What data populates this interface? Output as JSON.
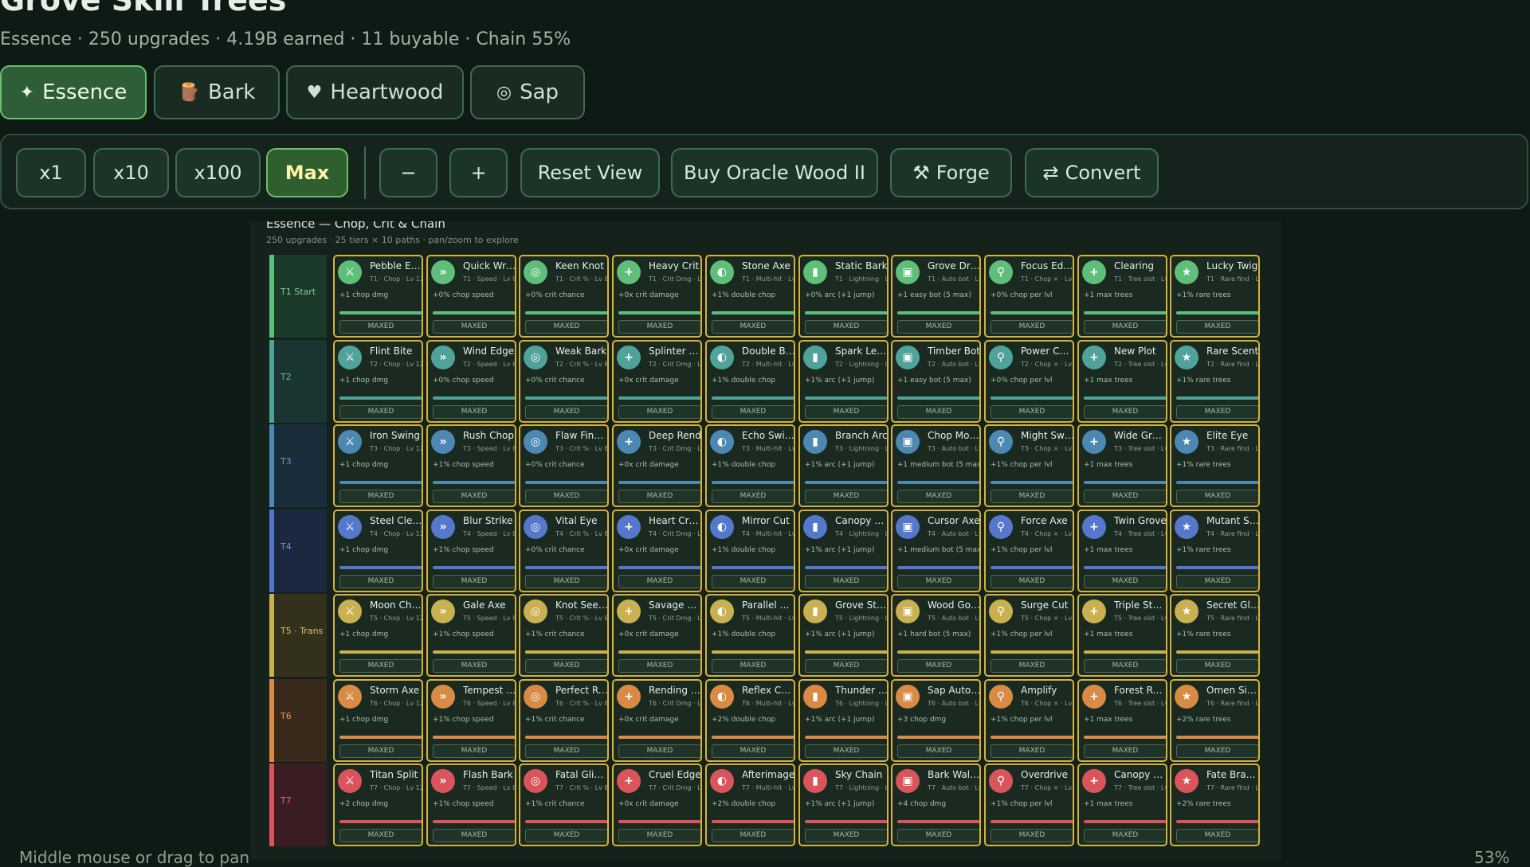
{
  "header": {
    "title": "Grove Skill Trees",
    "subtitle": "Essence · 250 upgrades · 4.19B earned · 11 buyable · Chain 55%"
  },
  "tabs": [
    {
      "icon": "✦",
      "label": "Essence",
      "active": true
    },
    {
      "icon": "🪵",
      "label": "Bark",
      "active": false
    },
    {
      "icon": "♥",
      "label": "Heartwood",
      "active": false
    },
    {
      "icon": "◎",
      "label": "Sap",
      "active": false
    }
  ],
  "toolbar": {
    "qty": [
      "x1",
      "x10",
      "x100",
      "Max"
    ],
    "qty_active": "Max",
    "zoom_out": "−",
    "zoom_in": "+",
    "reset": "Reset View",
    "buy": "Buy Oracle Wood II",
    "forge_icon": "⚒",
    "forge": "Forge",
    "convert_icon": "⇄",
    "convert": "Convert"
  },
  "board": {
    "title": "Essence — Chop, Crit & Chain",
    "subtitle": "250 upgrades · 25 tiers × 10 paths · pan/zoom to explore"
  },
  "tiers": [
    {
      "label": "T1 Start",
      "color": "#5fbf7a",
      "bg": "#1c3a2a",
      "text": "#7fcf8f"
    },
    {
      "label": "T2",
      "color": "#4fa39a",
      "bg": "#1a3532",
      "text": "#6fb3aa"
    },
    {
      "label": "T3",
      "color": "#4d88b3",
      "bg": "#1a2d3a",
      "text": "#6d98c3"
    },
    {
      "label": "T4",
      "color": "#5577cc",
      "bg": "#1c2740",
      "text": "#7597dc"
    },
    {
      "label": "T5 · Trans",
      "color": "#c9b050",
      "bg": "#33301e",
      "text": "#d9c070"
    },
    {
      "label": "T6",
      "color": "#d98a45",
      "bg": "#3a2a1c",
      "text": "#e99a55"
    },
    {
      "label": "T7",
      "color": "#d9555b",
      "bg": "#3a1d22",
      "text": "#e9656b"
    }
  ],
  "paths": [
    {
      "icon": "⚔",
      "effect": "+1 chop dmg",
      "meta": "Chop · Lv 12"
    },
    {
      "icon": "»",
      "effect": "+0% chop speed",
      "meta": "Speed · Lv 8"
    },
    {
      "icon": "◎",
      "effect": "+0% crit chance",
      "meta": "Crit % · Lv 8"
    },
    {
      "icon": "+",
      "effect": "+0x crit damage",
      "meta": "Crit Dmg · Lv"
    },
    {
      "icon": "◐",
      "effect": "+1% double chop",
      "meta": "Multi-hit · Lv"
    },
    {
      "icon": "▮",
      "effect": "+0% arc (+1 jump)",
      "meta": "Lightning · Lv"
    },
    {
      "icon": "▣",
      "effect": "+1 easy bot (5 max)",
      "meta": "Auto bot · Lv"
    },
    {
      "icon": "⚲",
      "effect": "+0% chop per lvl",
      "meta": "Chop × · Lv 5"
    },
    {
      "icon": "+",
      "effect": "+1 max trees",
      "meta": "Tree slot · Lv"
    },
    {
      "icon": "★",
      "effect": "+1% rare trees",
      "meta": "Rare find · Lv 6"
    }
  ],
  "maxed_label": "MAXED",
  "grid": [
    [
      {
        "name": "Pebble Edge",
        "tier": "T1",
        "effect": "+1 chop dmg"
      },
      {
        "name": "Quick Wrist",
        "tier": "T1",
        "effect": "+0% chop speed"
      },
      {
        "name": "Keen Knot",
        "tier": "T1",
        "effect": "+0% crit chance"
      },
      {
        "name": "Heavy Crit",
        "tier": "T1",
        "effect": "+0x crit damage"
      },
      {
        "name": "Stone Axe",
        "tier": "T1",
        "effect": "+1% double chop"
      },
      {
        "name": "Static Bark",
        "tier": "T1",
        "effect": "+0% arc (+1 jump)"
      },
      {
        "name": "Grove Drone",
        "tier": "T1",
        "effect": "+1 easy bot (5 max)"
      },
      {
        "name": "Focus Edge",
        "tier": "T1",
        "effect": "+0% chop per lvl"
      },
      {
        "name": "Clearing",
        "tier": "T1",
        "effect": "+1 max trees"
      },
      {
        "name": "Lucky Twig",
        "tier": "T1",
        "effect": "+1% rare trees"
      }
    ],
    [
      {
        "name": "Flint Bite",
        "tier": "T2",
        "effect": "+1 chop dmg"
      },
      {
        "name": "Wind Edge",
        "tier": "T2",
        "effect": "+0% chop speed"
      },
      {
        "name": "Weak Bark",
        "tier": "T2",
        "effect": "+0% crit chance"
      },
      {
        "name": "Splinter Burst",
        "tier": "T2",
        "effect": "+0x crit damage"
      },
      {
        "name": "Double Bite",
        "tier": "T2",
        "effect": "+1% double chop"
      },
      {
        "name": "Spark Leap",
        "tier": "T2",
        "effect": "+1% arc (+1 jump)"
      },
      {
        "name": "Timber Bot",
        "tier": "T2",
        "effect": "+1 easy bot (5 max)"
      },
      {
        "name": "Power Chop",
        "tier": "T2",
        "effect": "+0% chop per lvl"
      },
      {
        "name": "New Plot",
        "tier": "T2",
        "effect": "+1 max trees"
      },
      {
        "name": "Rare Scent",
        "tier": "T2",
        "effect": "+1% rare trees"
      }
    ],
    [
      {
        "name": "Iron Swing",
        "tier": "T3",
        "effect": "+1 chop dmg"
      },
      {
        "name": "Rush Chop",
        "tier": "T3",
        "effect": "+1% chop speed"
      },
      {
        "name": "Flaw Finder",
        "tier": "T3",
        "effect": "+0% crit chance"
      },
      {
        "name": "Deep Rend",
        "tier": "T3",
        "effect": "+0x crit damage"
      },
      {
        "name": "Echo Swing",
        "tier": "T3",
        "effect": "+1% double chop"
      },
      {
        "name": "Branch Arc",
        "tier": "T3",
        "effect": "+1% arc (+1 jump)"
      },
      {
        "name": "Chop Mouser",
        "tier": "T3",
        "effect": "+1 medium bot (5 max)"
      },
      {
        "name": "Might Swing",
        "tier": "T3",
        "effect": "+1% chop per lvl"
      },
      {
        "name": "Wide Grove",
        "tier": "T3",
        "effect": "+1 max trees"
      },
      {
        "name": "Elite Eye",
        "tier": "T3",
        "effect": "+1% rare trees"
      }
    ],
    [
      {
        "name": "Steel Cleaver",
        "tier": "T4",
        "effect": "+1 chop dmg"
      },
      {
        "name": "Blur Strike",
        "tier": "T4",
        "effect": "+1% chop speed"
      },
      {
        "name": "Vital Eye",
        "tier": "T4",
        "effect": "+0% crit chance"
      },
      {
        "name": "Heart Crack",
        "tier": "T4",
        "effect": "+0x crit damage"
      },
      {
        "name": "Mirror Cut",
        "tier": "T4",
        "effect": "+1% double chop"
      },
      {
        "name": "Canopy Bolt",
        "tier": "T4",
        "effect": "+1% arc (+1 jump)"
      },
      {
        "name": "Cursor Axe",
        "tier": "T4",
        "effect": "+1 medium bot (5 max)"
      },
      {
        "name": "Force Axe",
        "tier": "T4",
        "effect": "+1% chop per lvl"
      },
      {
        "name": "Twin Grove",
        "tier": "T4",
        "effect": "+1 max trees"
      },
      {
        "name": "Mutant Sense",
        "tier": "T4",
        "effect": "+1% rare trees"
      }
    ],
    [
      {
        "name": "Moon Chop",
        "tier": "T5",
        "effect": "+1 chop dmg"
      },
      {
        "name": "Gale Axe",
        "tier": "T5",
        "effect": "+1% chop speed"
      },
      {
        "name": "Knot Seeker",
        "tier": "T5",
        "effect": "+1% crit chance"
      },
      {
        "name": "Savage Mark",
        "tier": "T5",
        "effect": "+0x crit damage"
      },
      {
        "name": "Parallel Axe",
        "tier": "T5",
        "effect": "+1% double chop"
      },
      {
        "name": "Grove Storm",
        "tier": "T5",
        "effect": "+1% arc (+1 jump)"
      },
      {
        "name": "Wood Golem",
        "tier": "T5",
        "effect": "+1 hard bot (5 max)"
      },
      {
        "name": "Surge Cut",
        "tier": "T5",
        "effect": "+1% chop per lvl"
      },
      {
        "name": "Triple Stand",
        "tier": "T5",
        "effect": "+1 max trees"
      },
      {
        "name": "Secret Glimmer",
        "tier": "T5",
        "effect": "+1% rare trees"
      }
    ],
    [
      {
        "name": "Storm Axe",
        "tier": "T6",
        "effect": "+1 chop dmg"
      },
      {
        "name": "Tempest Axe",
        "tier": "T6",
        "effect": "+1% chop speed"
      },
      {
        "name": "Perfect Rend",
        "tier": "T6",
        "effect": "+1% crit chance"
      },
      {
        "name": "Rending Blow",
        "tier": "T6",
        "effect": "+0x crit damage"
      },
      {
        "name": "Reflex Chop",
        "tier": "T6",
        "effect": "+2% double chop"
      },
      {
        "name": "Thunder Line",
        "tier": "T6",
        "effect": "+1% arc (+1 jump)"
      },
      {
        "name": "Sap Automaton",
        "tier": "T6",
        "effect": "+3 chop dmg"
      },
      {
        "name": "Amplify",
        "tier": "T6",
        "effect": "+1% chop per lvl"
      },
      {
        "name": "Forest Room",
        "tier": "T6",
        "effect": "+1 max trees"
      },
      {
        "name": "Omen Sight",
        "tier": "T6",
        "effect": "+2% rare trees"
      }
    ],
    [
      {
        "name": "Titan Split",
        "tier": "T7",
        "effect": "+2 chop dmg"
      },
      {
        "name": "Flash Bark",
        "tier": "T7",
        "effect": "+1% chop speed"
      },
      {
        "name": "Fatal Glimmer",
        "tier": "T7",
        "effect": "+1% crit chance"
      },
      {
        "name": "Cruel Edge",
        "tier": "T7",
        "effect": "+0x crit damage"
      },
      {
        "name": "Afterimage",
        "tier": "T7",
        "effect": "+2% double chop"
      },
      {
        "name": "Sky Chain",
        "tier": "T7",
        "effect": "+1% arc (+1 jump)"
      },
      {
        "name": "Bark Walker",
        "tier": "T7",
        "effect": "+4 chop dmg"
      },
      {
        "name": "Overdrive",
        "tier": "T7",
        "effect": "+1% chop per lvl"
      },
      {
        "name": "Canopy Span",
        "tier": "T7",
        "effect": "+1 max trees"
      },
      {
        "name": "Fate Branch",
        "tier": "T7",
        "effect": "+2% rare trees"
      }
    ]
  ],
  "footer": {
    "hint": "Middle mouse or drag to pan",
    "zoom": "53%"
  },
  "colors": {
    "card_border": "#d6b23a",
    "active_tab": "#2d5e37",
    "page_bg": "#0e1a14"
  }
}
